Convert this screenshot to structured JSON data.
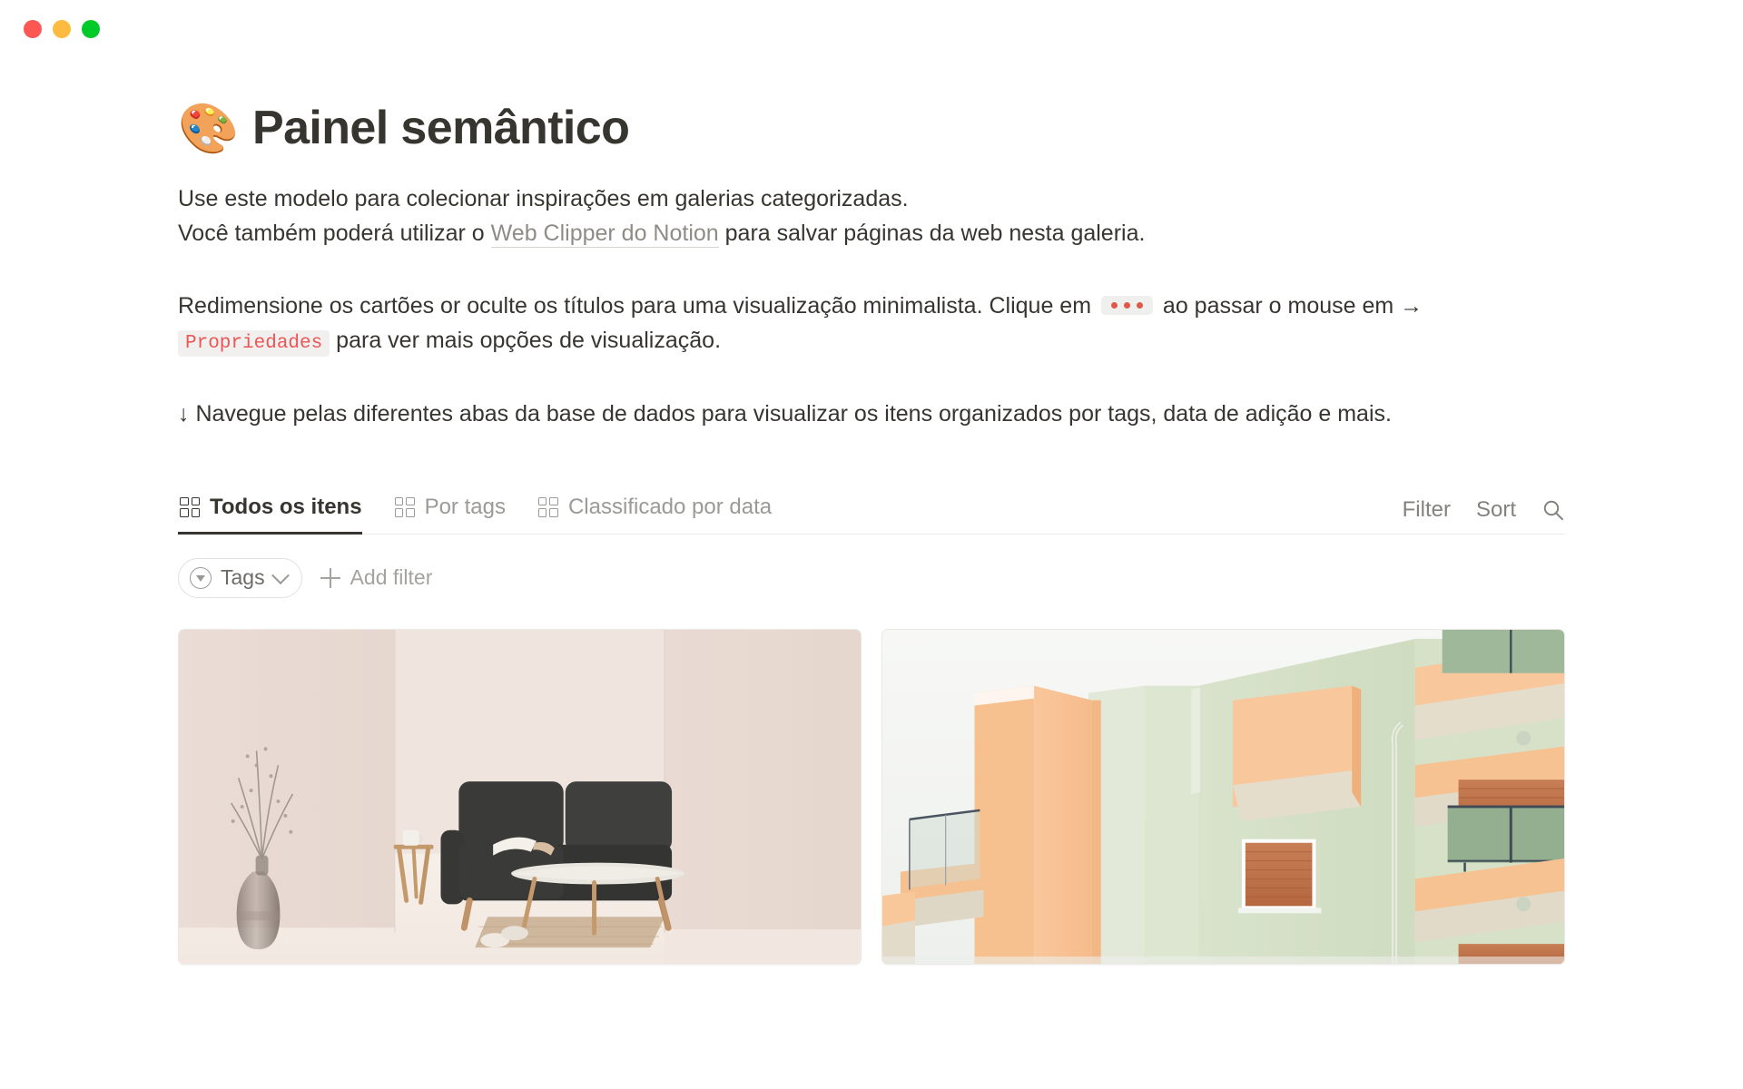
{
  "window": {
    "traffic_lights": [
      {
        "name": "close",
        "color": "#FC5753"
      },
      {
        "name": "minimize",
        "color": "#FDBC40"
      },
      {
        "name": "maximize",
        "color": "#00CA2A"
      }
    ]
  },
  "page": {
    "emoji": "🎨",
    "title": "Painel semântico"
  },
  "paragraphs": {
    "p1_line1": "Use este modelo para colecionar inspirações em galerias categorizadas.",
    "p1_line2_before": "Você também poderá utilizar o ",
    "p1_link": "Web Clipper do Notion",
    "p1_line2_after": " para salvar páginas da web nesta galeria.",
    "p3_before": "Redimensione os cartões or oculte os títulos para uma visualização minimalista. Clique em ",
    "p3_mid": " ao passar o mouse em → ",
    "p3_code": "Propriedades",
    "p3_after": " para ver mais opções de visualização.",
    "p4": "↓ Navegue pelas diferentes abas da base de dados para visualizar os itens organizados por tags, data de adição e mais."
  },
  "database": {
    "tabs": [
      {
        "label": "Todos os itens",
        "icon": "gallery-icon",
        "active": true
      },
      {
        "label": "Por tags",
        "icon": "gallery-icon",
        "active": false
      },
      {
        "label": "Classificado por data",
        "icon": "gallery-icon",
        "active": false
      }
    ],
    "toolbar": {
      "filter_label": "Filter",
      "sort_label": "Sort",
      "search_icon": "search-icon"
    },
    "filters": {
      "tags_chip_label": "Tags",
      "tags_chip_icon": "filter-circle-icon",
      "tags_chip_chevron": "chevron-down-icon",
      "add_filter_label": "Add filter",
      "add_filter_icon": "plus-icon"
    },
    "cards": [
      {
        "name": "interior-minimalista",
        "alt": "Interior minimalista em tons rosados com sofá escuro, vaso de vidro com ramos secos, mesa lateral de madeira e tapete de juta"
      },
      {
        "name": "arquitetura-pastel",
        "alt": "Fachada de edifício em tons pastel pêssego e verde menta com varandas e persianas contra céu branco"
      }
    ]
  },
  "colors": {
    "text": "#37352f",
    "muted": "#9b9a97",
    "link": "#8f8c86",
    "code_text": "#eb5757",
    "chip_bg": "#efefed",
    "dot_red": "#e1574c",
    "tab_underline": "#37352f"
  }
}
